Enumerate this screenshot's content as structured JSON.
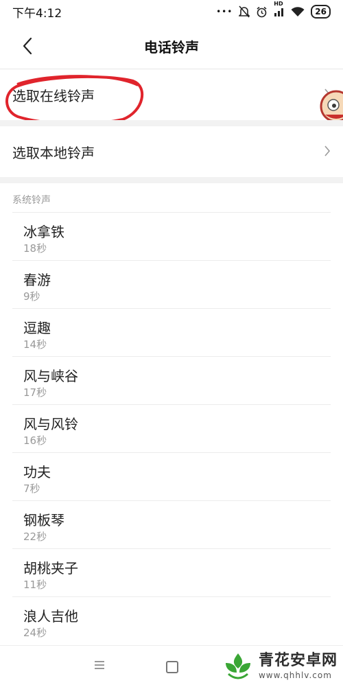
{
  "status_bar": {
    "time": "下午4:12",
    "dots": "•••",
    "hd": "HD",
    "battery": "26"
  },
  "header": {
    "title": "电话铃声"
  },
  "options": [
    {
      "label": "选取在线铃声"
    },
    {
      "label": "选取本地铃声"
    }
  ],
  "section": {
    "label": "系统铃声"
  },
  "ringtones": [
    {
      "name": "冰拿铁",
      "duration": "18秒"
    },
    {
      "name": "春游",
      "duration": "9秒"
    },
    {
      "name": "逗趣",
      "duration": "14秒"
    },
    {
      "name": "风与峡谷",
      "duration": "17秒"
    },
    {
      "name": "风与风铃",
      "duration": "16秒"
    },
    {
      "name": "功夫",
      "duration": "7秒"
    },
    {
      "name": "钢板琴",
      "duration": "22秒"
    },
    {
      "name": "胡桃夹子",
      "duration": "11秒"
    },
    {
      "name": "浪人吉他",
      "duration": "24秒"
    }
  ],
  "nav": {
    "menu_icon": "menu-icon",
    "home_icon": "home-icon"
  },
  "watermark": {
    "title": "青花安卓网",
    "url": "www.qhhlv.com"
  },
  "colors": {
    "annotation": "#e0242c",
    "watermark_green": "#3aa635"
  }
}
